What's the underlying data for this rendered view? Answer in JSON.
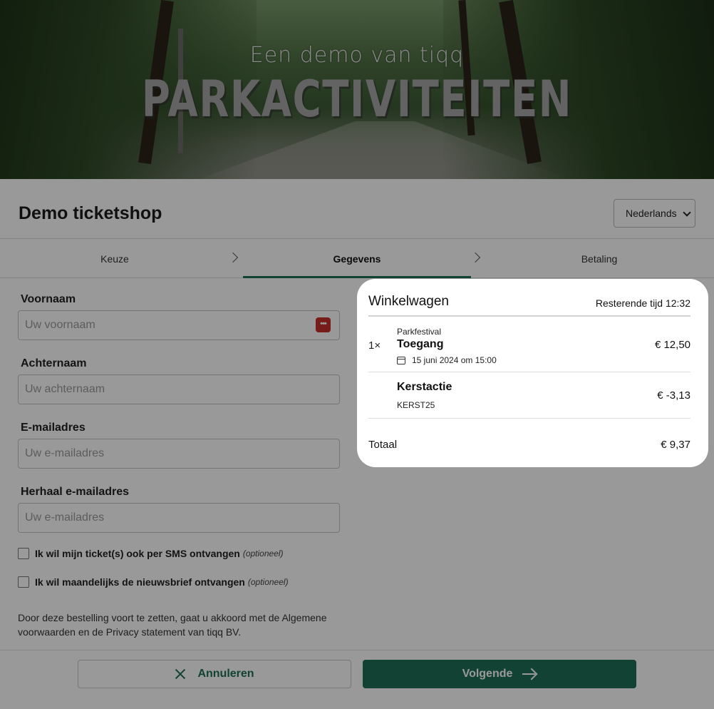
{
  "hero": {
    "subtitle": "Een demo van tiqq",
    "title": "PARKACTIVITEITEN"
  },
  "header": {
    "shop_title": "Demo ticketshop",
    "language": "Nederlands"
  },
  "steps": [
    {
      "label": "Keuze"
    },
    {
      "label": "Gegevens",
      "active": true
    },
    {
      "label": "Betaling"
    }
  ],
  "form": {
    "first_name": {
      "label": "Voornaam",
      "placeholder": "Uw voornaam"
    },
    "last_name": {
      "label": "Achternaam",
      "placeholder": "Uw achternaam"
    },
    "email": {
      "label": "E-mailadres",
      "placeholder": "Uw e-mailadres"
    },
    "email_repeat": {
      "label": "Herhaal e-mailadres",
      "placeholder": "Uw e-mailadres"
    },
    "sms_option": {
      "label": "Ik wil mijn ticket(s) ook per SMS ontvangen",
      "optional": "(optioneel)",
      "checked": false
    },
    "newsletter_option": {
      "label": "Ik wil maandelijks de nieuwsbrief ontvangen",
      "optional": "(optioneel)",
      "checked": false
    },
    "terms_text": "Door deze bestelling voort te zetten, gaat u akkoord met de Algemene voorwaarden en de Privacy statement van tiqq BV."
  },
  "footer": {
    "cancel_label": "Annuleren",
    "next_label": "Volgende",
    "accent_color": "#1d6f55"
  },
  "cart": {
    "title": "Winkelwagen",
    "timer": "Resterende tijd 12:32",
    "items": [
      {
        "qty": "1×",
        "event": "Parkfestival",
        "name": "Toegang",
        "date": "15 juni 2024 om 15:00",
        "price": "€ 12,50"
      }
    ],
    "discount": {
      "name": "Kerstactie",
      "code": "KERST25",
      "price": "€ -3,13"
    },
    "total_label": "Totaal",
    "total": "€ 9,37"
  }
}
